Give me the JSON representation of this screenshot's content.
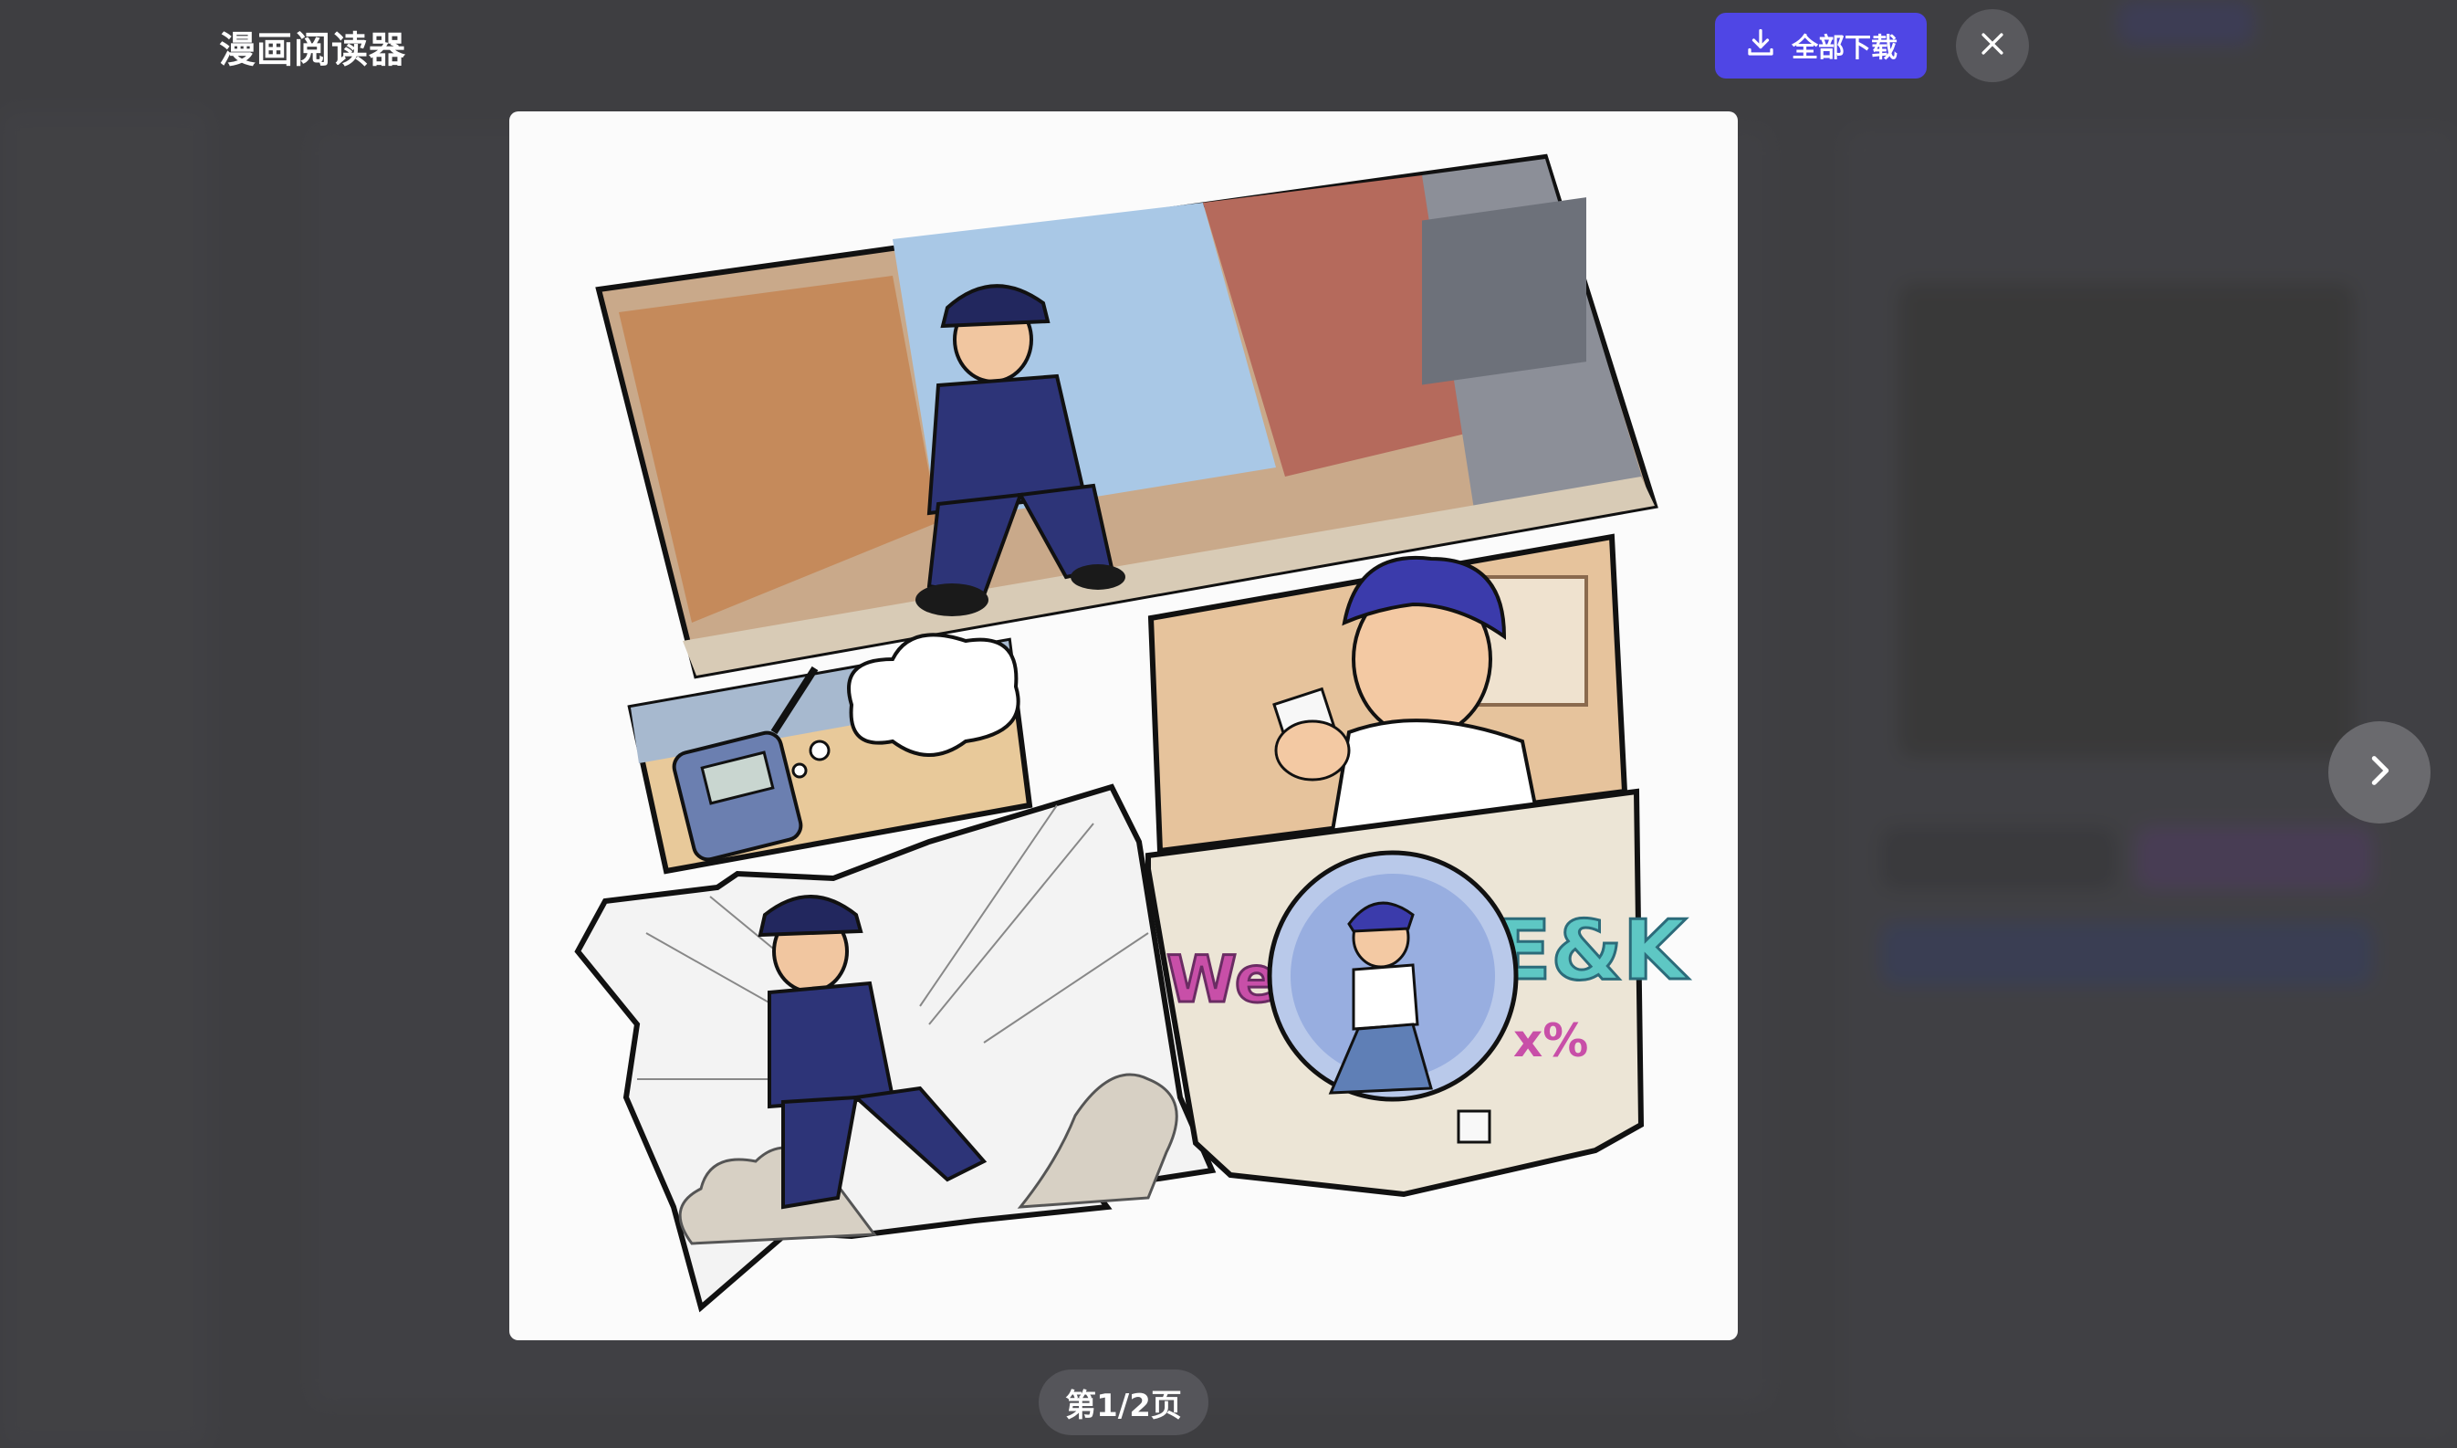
{
  "reader": {
    "title": "漫画阅读器",
    "download_all_label": "全部下载",
    "page_indicator": "第1/2页",
    "current_page": 1,
    "total_pages": 2
  },
  "icons": {
    "download": "download-icon",
    "close": "close-icon",
    "next": "chevron-right-icon"
  },
  "colors": {
    "accent": "#4f46e5",
    "overlay": "#3f3f42",
    "panel_bg": "#fbfbfb"
  }
}
